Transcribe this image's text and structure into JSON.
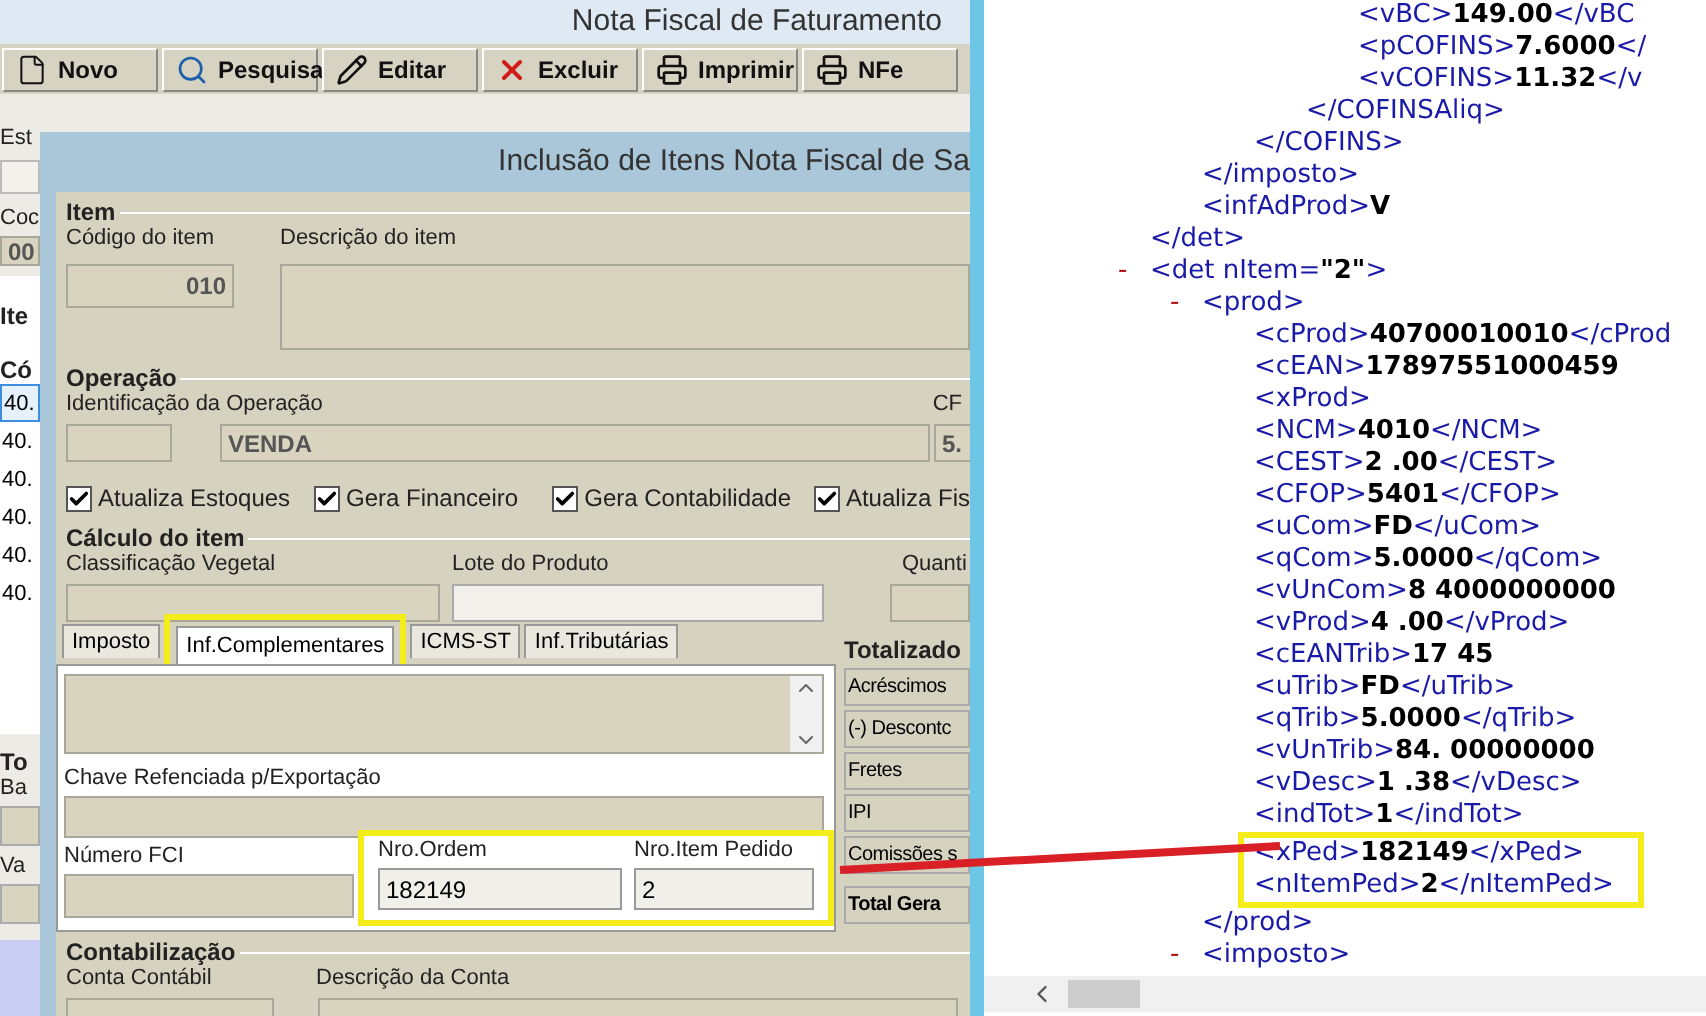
{
  "main_window": {
    "title": "Nota Fiscal de Faturamento",
    "toolbar": [
      {
        "label": "Novo",
        "kind": "document"
      },
      {
        "label": "Pesquisa",
        "kind": "search"
      },
      {
        "label": "Editar",
        "kind": "pencil"
      },
      {
        "label": "Excluir",
        "kind": "delete"
      },
      {
        "label": "Imprimir",
        "kind": "printer"
      },
      {
        "label": "NFe",
        "kind": "printer"
      }
    ],
    "column_1": {
      "label_1": "Est",
      "label_2": "Coc",
      "field_value": "00",
      "section": "Ite",
      "column_header": "Có",
      "rows": [
        {
          "text": "40.",
          "selected": true
        },
        {
          "text": "40.",
          "selected": false
        },
        {
          "text": "40.",
          "selected": false
        },
        {
          "text": "40.",
          "selected": false
        },
        {
          "text": "40.",
          "selected": false
        },
        {
          "text": "40.",
          "selected": false
        }
      ]
    },
    "totals": {
      "heading": "To",
      "label_1": "Ba",
      "label_2": "Va"
    }
  },
  "dialog": {
    "title": "Inclusão de Itens  Nota Fiscal de Sa",
    "item": {
      "heading": "Item",
      "code_label": "Código do item",
      "code": "010",
      "description_label": "Descrição do item"
    },
    "operation": {
      "heading": "Operação",
      "label": "Identificação da Operação",
      "value": "VENDA",
      "cfop_label": "CF",
      "cfop": "5."
    },
    "checks": [
      {
        "label": "Atualiza Estoques",
        "checked": true
      },
      {
        "label": "Gera Financeiro",
        "checked": true
      },
      {
        "label": "Gera Contabilidade",
        "checked": true
      },
      {
        "label": "Atualiza Fis",
        "checked": true
      }
    ],
    "calc": {
      "heading": "Cálculo do item",
      "labels": [
        "Classificação Vegetal",
        "Lote do Produto",
        "Quanti"
      ]
    },
    "tabs": [
      {
        "label": "Imposto",
        "selected": false,
        "highlighted": false
      },
      {
        "label": "Inf.Complementares",
        "selected": true,
        "highlighted": true
      },
      {
        "label": "ICMS-ST",
        "selected": false,
        "highlighted": false
      },
      {
        "label": "Inf.Tributárias",
        "selected": false,
        "highlighted": false
      }
    ],
    "panel": {
      "export_key_label": "Chave Refenciada p/Exportação",
      "fci_label": "Número FCI",
      "order_fields": {
        "highlighted": true,
        "fields": [
          {
            "label": "Nro.Ordem",
            "value": "182149"
          },
          {
            "label": "Nro.Item Pedido",
            "value": "2"
          }
        ]
      }
    },
    "totals": {
      "heading": "Totalizado",
      "items": [
        "Acréscimos",
        "(-) Descontc",
        "Fretes",
        "IPI",
        "Comissões s",
        "Total Gera"
      ]
    },
    "accounting": {
      "heading": "Contabilização",
      "labels": [
        "Conta Contábil",
        "Descrição da Conta"
      ]
    }
  },
  "xml": {
    "nodes": [
      {
        "children": [
          {
            "children": [
              {
                "children": [
                  {
                    "children": [
                      {
                        "open": "<vBC>",
                        "value": "149.00",
                        "close": "</vBC"
                      },
                      {
                        "open": "<pCOFINS>",
                        "value": "7.6000",
                        "close": "</"
                      },
                      {
                        "open": "<vCOFINS>",
                        "value": "11.32",
                        "close": "</v"
                      }
                    ]
                  },
                  {
                    "open": "</COFINSAliq>"
                  }
                ]
              },
              {
                "open": "</COFINS>"
              }
            ]
          },
          {
            "open": "</imposto>"
          },
          {
            "open": "<infAdProd>",
            "value": "V"
          }
        ]
      },
      {
        "open": "</det>"
      },
      {
        "toggle": "-",
        "open": "<det nItem=",
        "value": "\"2\"",
        "close": ">",
        "children": [
          {
            "toggle": "-",
            "open": "<prod>",
            "children": [
              {
                "open": "<cProd>",
                "value": "40700010010",
                "close": "</cProd"
              },
              {
                "open": "<cEAN>",
                "value": "17897551000459"
              },
              {
                "open": "<xProd>"
              },
              {
                "open": "<NCM>",
                "value": "4010",
                "close": "</NCM>"
              },
              {
                "open": "<CEST>",
                "value": "2 .00",
                "close": "</CEST>"
              },
              {
                "open": "<CFOP>",
                "value": "5401",
                "close": "</CFOP>"
              },
              {
                "open": "<uCom>",
                "value": "FD",
                "close": "</uCom>"
              },
              {
                "open": "<qCom>",
                "value": "5.0000",
                "close": "</qCom>"
              },
              {
                "open": "<vUnCom>",
                "value": "8  4000000000"
              },
              {
                "open": "<vProd>",
                "value": "4 .00",
                "close": "</vProd>"
              },
              {
                "open": "<cEANTrib>",
                "value": "17 45"
              },
              {
                "open": "<uTrib>",
                "value": "FD",
                "close": "</uTrib>"
              },
              {
                "open": "<qTrib>",
                "value": "5.0000",
                "close": "</qTrib>"
              },
              {
                "open": "<vUnTrib>",
                "value": "84. 00000000"
              },
              {
                "open": "<vDesc>",
                "value": "1 .38",
                "close": "</vDesc>"
              },
              {
                "open": "<indTot>",
                "value": "1",
                "close": "</indTot>"
              },
              {
                "open": "<xPed>",
                "value": "182149",
                "close": "</xPed>",
                "highlighted": true
              },
              {
                "open": "<nItemPed>",
                "value": "2",
                "close": "</nItemPed>",
                "highlighted": true
              }
            ]
          },
          {
            "open": "</prod>"
          },
          {
            "toggle": "-",
            "open": "<imposto>"
          }
        ]
      }
    ]
  }
}
